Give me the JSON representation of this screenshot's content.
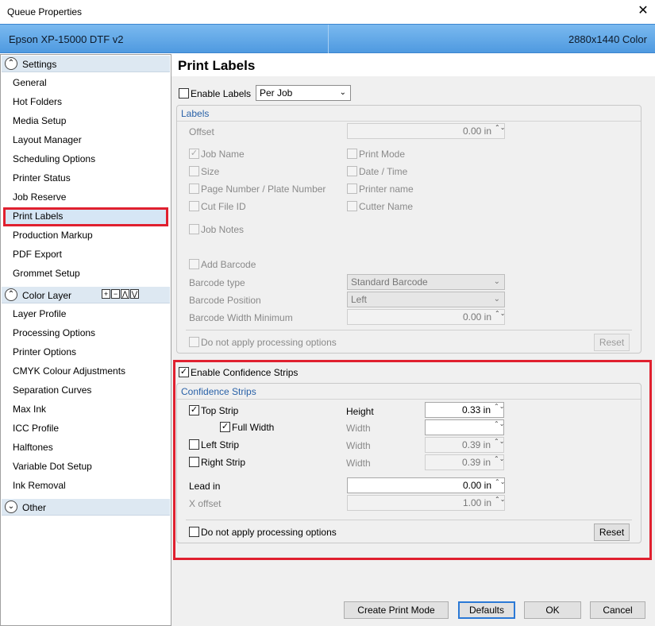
{
  "window": {
    "title": "Queue Properties",
    "close_label": "✕"
  },
  "banner": {
    "printer": "Epson XP-15000 DTF v2",
    "resolution": "2880x1440 Color"
  },
  "sidebar": {
    "settings_group": "Settings",
    "settings_items": [
      "General",
      "Hot Folders",
      "Media Setup",
      "Layout Manager",
      "Scheduling Options",
      "Printer Status",
      "Job Reserve",
      "Print Labels",
      "Production Markup",
      "PDF Export",
      "Grommet Setup"
    ],
    "color_group": "Color Layer",
    "color_tools": [
      "+",
      "−",
      "⋀",
      "⋁"
    ],
    "color_items": [
      "Layer Profile",
      "Processing Options",
      "Printer Options",
      "CMYK Colour Adjustments",
      "Separation Curves",
      "Max Ink",
      "ICC Profile",
      "Halftones",
      "Variable Dot Setup",
      "Ink Removal"
    ],
    "other_group": "Other"
  },
  "page": {
    "title": "Print Labels"
  },
  "labels": {
    "enable": "Enable Labels",
    "mode": "Per Job",
    "group_title": "Labels",
    "offset_label": "Offset",
    "offset_value": "0.00 in",
    "job_name": "Job Name",
    "print_mode": "Print Mode",
    "size": "Size",
    "date_time": "Date / Time",
    "page_number": "Page Number / Plate Number",
    "printer_name": "Printer name",
    "cut_file_id": "Cut File ID",
    "cutter_name": "Cutter Name",
    "job_notes": "Job Notes",
    "add_barcode": "Add Barcode",
    "barcode_type_label": "Barcode type",
    "barcode_type": "Standard Barcode",
    "barcode_position_label": "Barcode Position",
    "barcode_position": "Left",
    "barcode_width_label": "Barcode Width Minimum",
    "barcode_width": "0.00 in",
    "no_processing": "Do not apply processing options",
    "reset": "Reset"
  },
  "confidence": {
    "enable": "Enable Confidence Strips",
    "group_title": "Confidence Strips",
    "top_strip": "Top Strip",
    "full_width": "Full Width",
    "left_strip": "Left Strip",
    "right_strip": "Right Strip",
    "height_label": "Height",
    "height_value": "0.33 in",
    "width_label": "Width",
    "width_value": "",
    "left_width_label": "Width",
    "left_width": "0.39 in",
    "right_width_label": "Width",
    "right_width": "0.39 in",
    "lead_in_label": "Lead in",
    "lead_in": "0.00 in",
    "x_offset_label": "X offset",
    "x_offset": "1.00 in",
    "no_processing": "Do not apply processing options",
    "reset": "Reset"
  },
  "footer": {
    "create_print_mode": "Create Print Mode",
    "defaults": "Defaults",
    "ok": "OK",
    "cancel": "Cancel"
  },
  "check": "✓",
  "spin_arrows": "⌃⌄",
  "accent": {
    "highlight": "#e0202f",
    "banner": "#5aa3e6"
  }
}
